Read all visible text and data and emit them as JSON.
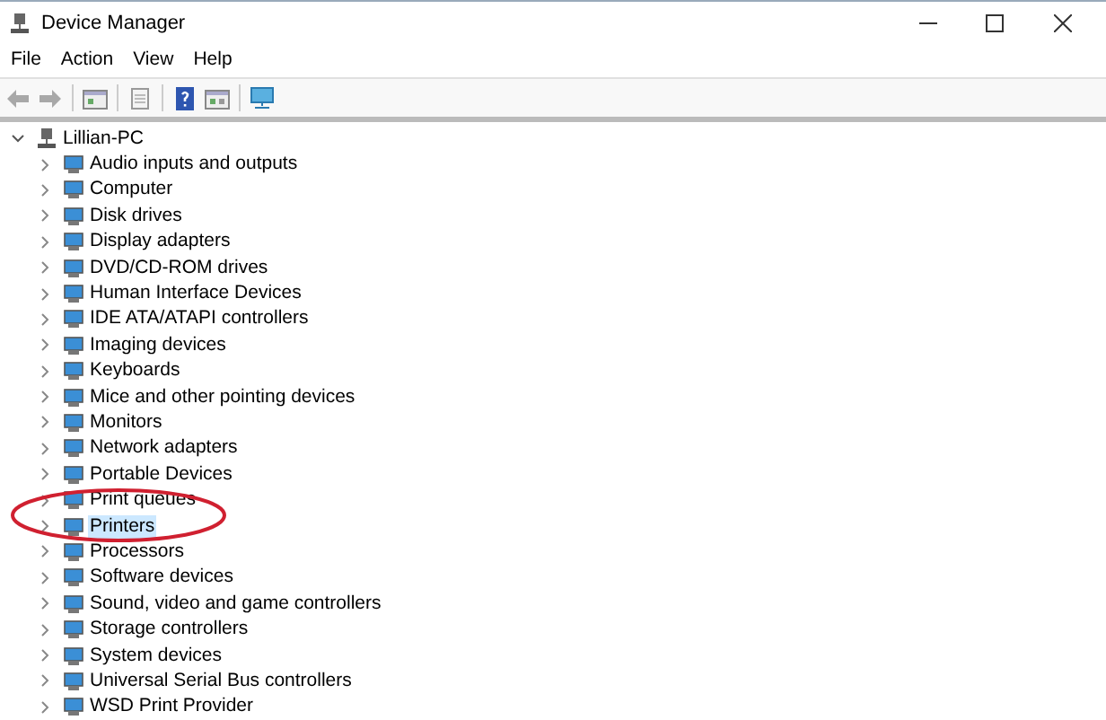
{
  "window": {
    "title": "Device Manager"
  },
  "menu": [
    "File",
    "Action",
    "View",
    "Help"
  ],
  "tree": {
    "label": "Lillian-PC",
    "expanded": true,
    "selected": false,
    "children": [
      {
        "label": "Audio inputs and outputs",
        "expanded": false,
        "selected": false
      },
      {
        "label": "Computer",
        "expanded": false,
        "selected": false
      },
      {
        "label": "Disk drives",
        "expanded": false,
        "selected": false
      },
      {
        "label": "Display adapters",
        "expanded": false,
        "selected": false
      },
      {
        "label": "DVD/CD-ROM drives",
        "expanded": false,
        "selected": false
      },
      {
        "label": "Human Interface Devices",
        "expanded": false,
        "selected": false
      },
      {
        "label": "IDE ATA/ATAPI controllers",
        "expanded": false,
        "selected": false
      },
      {
        "label": "Imaging devices",
        "expanded": false,
        "selected": false
      },
      {
        "label": "Keyboards",
        "expanded": false,
        "selected": false
      },
      {
        "label": "Mice and other pointing devices",
        "expanded": false,
        "selected": false
      },
      {
        "label": "Monitors",
        "expanded": false,
        "selected": false
      },
      {
        "label": "Network adapters",
        "expanded": false,
        "selected": false
      },
      {
        "label": "Portable Devices",
        "expanded": false,
        "selected": false
      },
      {
        "label": "Print queues",
        "expanded": false,
        "selected": false
      },
      {
        "label": "Printers",
        "expanded": false,
        "selected": true
      },
      {
        "label": "Processors",
        "expanded": false,
        "selected": false
      },
      {
        "label": "Software devices",
        "expanded": false,
        "selected": false
      },
      {
        "label": "Sound, video and game controllers",
        "expanded": false,
        "selected": false
      },
      {
        "label": "Storage controllers",
        "expanded": false,
        "selected": false
      },
      {
        "label": "System devices",
        "expanded": false,
        "selected": false
      },
      {
        "label": "Universal Serial Bus controllers",
        "expanded": false,
        "selected": false
      },
      {
        "label": "WSD Print Provider",
        "expanded": false,
        "selected": false
      }
    ]
  }
}
